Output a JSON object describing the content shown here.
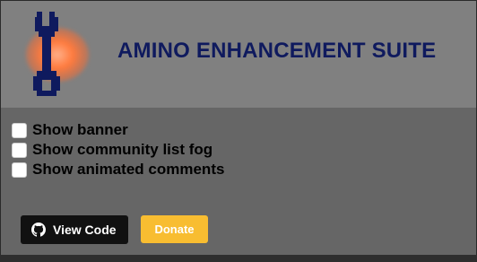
{
  "header": {
    "title": "AMINO ENHANCEMENT SUITE",
    "logo_icon": "wrench-icon",
    "colors": {
      "header_bg": "#808080",
      "title": "#0f1a5e",
      "logo_glow": "#ff7a3d"
    }
  },
  "options": [
    {
      "label": "Show banner",
      "checked": false
    },
    {
      "label": "Show community list fog",
      "checked": false
    },
    {
      "label": "Show animated comments",
      "checked": false
    }
  ],
  "footer": {
    "view_code_label": "View Code",
    "view_code_icon": "github-icon",
    "donate_label": "Donate",
    "colors": {
      "view_code_bg": "#111111",
      "donate_bg": "#f8bd31"
    }
  }
}
